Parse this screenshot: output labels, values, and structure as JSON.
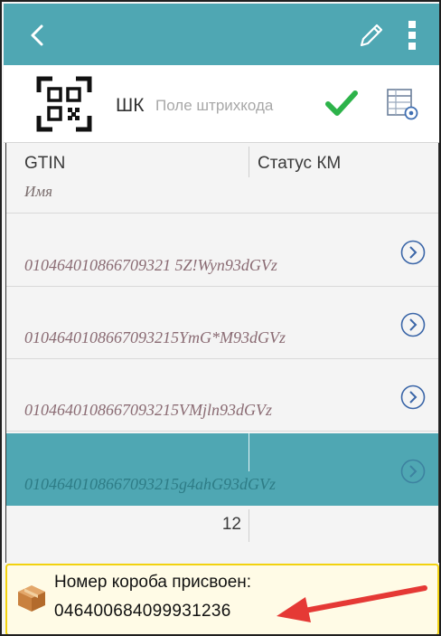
{
  "header": {
    "back_icon": "chevron-left-icon",
    "edit_icon": "pencil-icon",
    "menu_icon": "more-vertical-icon",
    "bar_color": "#4fa7b3"
  },
  "scan": {
    "qr_icon": "qr-code-icon",
    "label": "ШК",
    "placeholder": "Поле штрихкода",
    "confirm_icon": "checkmark-icon",
    "confirm_color": "#2db34a",
    "settings_icon": "table-settings-icon"
  },
  "table": {
    "columns": {
      "gtin": "GTIN",
      "status": "Статус КМ",
      "name": "Имя"
    },
    "rows": [
      {
        "code": "010464010866709321 5Z!Wyn93dGVz",
        "selected": false
      },
      {
        "code": "0104640108667093215YmG*M93dGVz",
        "selected": false
      },
      {
        "code": "0104640108667093215VMjln93dGVz",
        "selected": false
      },
      {
        "code": "0104640108667093215g4ahG93dGVz",
        "selected": true
      }
    ],
    "count": "12",
    "selected_color": "#4fa7b3"
  },
  "toast": {
    "icon": "package-box-icon",
    "line1": "Номер короба присвоен:",
    "line2": "046400684099931236",
    "border_color": "#f2d20f",
    "annotation_arrow_color": "#e53935"
  }
}
